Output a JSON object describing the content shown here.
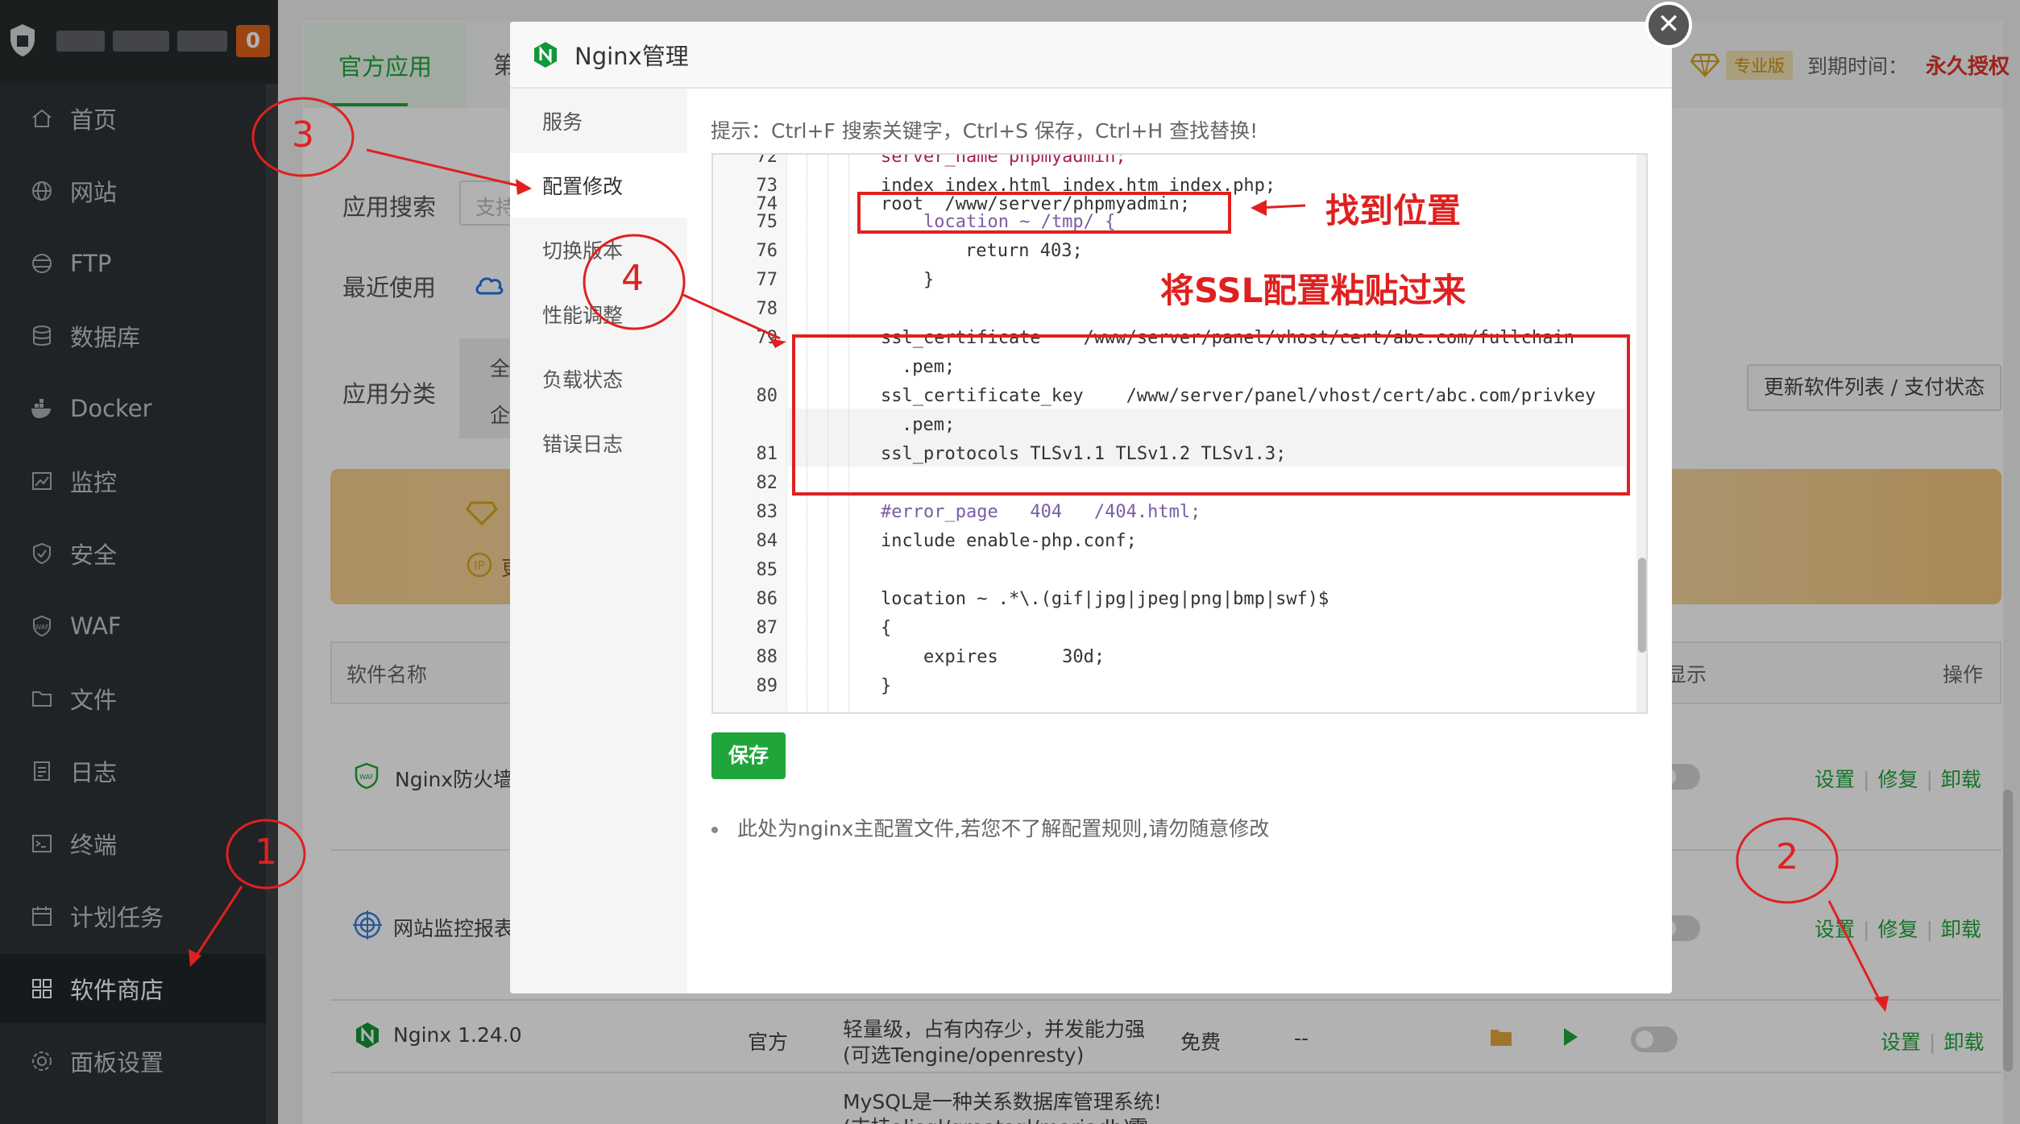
{
  "sidebar": {
    "badge": "0",
    "items": [
      {
        "label": "首页",
        "icon": "home-icon"
      },
      {
        "label": "网站",
        "icon": "globe-icon"
      },
      {
        "label": "FTP",
        "icon": "ftp-icon"
      },
      {
        "label": "数据库",
        "icon": "database-icon"
      },
      {
        "label": "Docker",
        "icon": "docker-icon"
      },
      {
        "label": "监控",
        "icon": "monitor-icon"
      },
      {
        "label": "安全",
        "icon": "shield-icon"
      },
      {
        "label": "WAF",
        "icon": "waf-icon"
      },
      {
        "label": "文件",
        "icon": "folder-icon"
      },
      {
        "label": "日志",
        "icon": "log-icon"
      },
      {
        "label": "终端",
        "icon": "terminal-icon"
      },
      {
        "label": "计划任务",
        "icon": "calendar-icon"
      },
      {
        "label": "软件商店",
        "icon": "apps-icon"
      },
      {
        "label": "面板设置",
        "icon": "gear-icon"
      }
    ],
    "active_index": 12
  },
  "header": {
    "tab_official": "官方应用",
    "tab_other": "第",
    "pro_tag": "专业版",
    "expire_label": "到期时间：",
    "expire_value": "永久授权"
  },
  "filters": {
    "search_label": "应用搜索",
    "search_placeholder": "支持",
    "recent_label": "最近使用",
    "category_label": "应用分类",
    "category_options": [
      "全",
      "企"
    ],
    "update_button": "更新软件列表 / 支付状态"
  },
  "banner": {
    "line2": "更"
  },
  "table": {
    "headers": {
      "name": "软件名称",
      "display": "显示",
      "action": "操作"
    },
    "rows": [
      {
        "name": "Nginx防火墙",
        "icon": "waf-shield-icon",
        "ops": [
          "设置",
          "修复",
          "卸载"
        ]
      },
      {
        "name": "网站监控报表",
        "icon": "target-icon",
        "ops": [
          "设置",
          "修复",
          "卸载"
        ]
      },
      {
        "name": "Nginx 1.24.0",
        "icon": "nginx-icon",
        "developer": "官方",
        "desc_line1": "轻量级，占有内存少，并发能力强",
        "desc_line2": "(可选Tengine/openresty)",
        "price": "免费",
        "expire": "--",
        "ops": [
          "设置",
          "卸载"
        ]
      },
      {
        "name": "",
        "desc_line1": "MySQL是一种关系数据库管理系统!",
        "desc_line2": "(支持alisql/greatsql/mariadb)",
        "suffix": "需"
      }
    ]
  },
  "modal": {
    "title": "Nginx管理",
    "nav": [
      "服务",
      "配置修改",
      "切换版本",
      "性能调整",
      "负载状态",
      "错误日志"
    ],
    "active_nav": 1,
    "tip": "提示：Ctrl+F 搜索关键字，Ctrl+S 保存，Ctrl+H 查找替换!",
    "save_button": "保存",
    "note": "此处为nginx主配置文件,若您不了解配置规则,请勿随意修改",
    "code": [
      {
        "ln": "72",
        "text": "server_name phpmyadmin;"
      },
      {
        "ln": "73",
        "text": "index index.html index.htm index.php;"
      },
      {
        "ln": "74",
        "text": "root  /www/server/phpmyadmin;"
      },
      {
        "ln": "75",
        "text": "location ~ /tmp/ {"
      },
      {
        "ln": "76",
        "text": "return 403;"
      },
      {
        "ln": "77",
        "text": "}"
      },
      {
        "ln": "78",
        "text": ""
      },
      {
        "ln": "79",
        "text": "ssl_certificate    /www/server/panel/vhost/cert/abc.com/fullchain"
      },
      {
        "ln": "",
        "text": ".pem;"
      },
      {
        "ln": "80",
        "text": "ssl_certificate_key    /www/server/panel/vhost/cert/abc.com/privkey"
      },
      {
        "ln": "",
        "text": ".pem;"
      },
      {
        "ln": "81",
        "text": "ssl_protocols TLSv1.1 TLSv1.2 TLSv1.3;"
      },
      {
        "ln": "82",
        "text": ""
      },
      {
        "ln": "83",
        "text": "#error_page   404   /404.html;"
      },
      {
        "ln": "84",
        "text": "include enable-php.conf;"
      },
      {
        "ln": "85",
        "text": ""
      },
      {
        "ln": "86",
        "text": "location ~ .*\\.(gif|jpg|jpeg|png|bmp|swf)$"
      },
      {
        "ln": "87",
        "text": "{"
      },
      {
        "ln": "88",
        "text": "expires      30d;"
      },
      {
        "ln": "89",
        "text": "}"
      }
    ]
  },
  "annotations": {
    "circles": [
      "1",
      "2",
      "3",
      "4"
    ],
    "find_position": "找到位置",
    "paste_ssl": "将SSL配置粘贴过来"
  },
  "colors": {
    "accent": "#20a53a",
    "annotation": "#e02020",
    "sidebar": "#2f3336"
  }
}
